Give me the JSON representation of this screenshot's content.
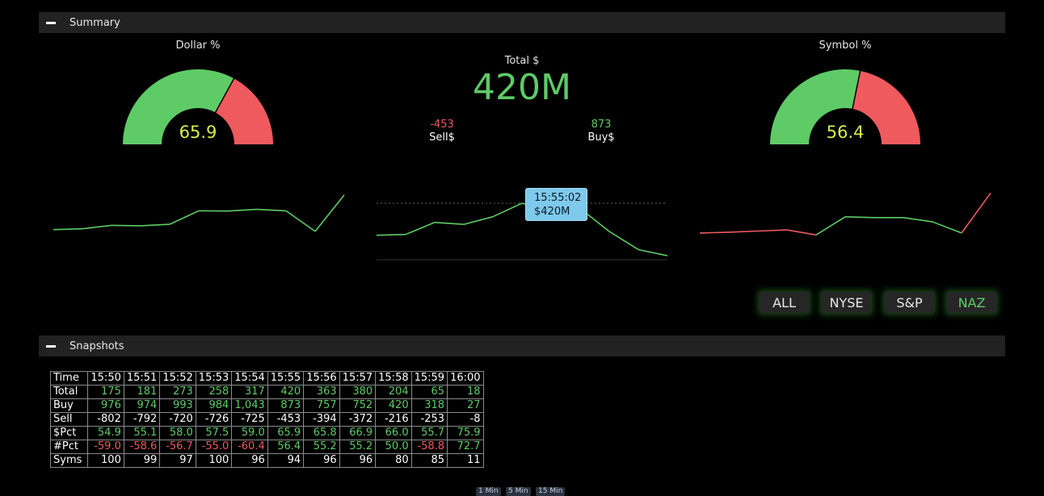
{
  "summary": {
    "title": "Summary"
  },
  "snapshots_section": {
    "title": "Snapshots"
  },
  "dollar_gauge": {
    "title": "Dollar %",
    "value": "65.9",
    "fraction": 0.659
  },
  "symbol_gauge": {
    "title": "Symbol %",
    "value": "56.4",
    "fraction": 0.564
  },
  "total": {
    "label": "Total $",
    "value": "420M"
  },
  "sell": {
    "value": "-453",
    "label": "Sell$"
  },
  "buy": {
    "value": "873",
    "label": "Buy$"
  },
  "tooltip": {
    "time": "15:55:02",
    "value": "$420M"
  },
  "colors": {
    "green": "#5ecb67",
    "red": "#ef5a5f",
    "gauge_text": "#d8f04a",
    "tooltip_bg": "#7ec9ec"
  },
  "charts": {
    "left_values": [
      420,
      440,
      520,
      510,
      545,
      860,
      855,
      895,
      860,
      380,
      1230
    ],
    "left_colors": [
      "green",
      "green",
      "green",
      "green",
      "green",
      "green",
      "green",
      "green",
      "green",
      "green"
    ],
    "middle_values": [
      175,
      181,
      273,
      258,
      317,
      420,
      363,
      380,
      204,
      65,
      18
    ],
    "middle_ref": 420,
    "right_values": [
      55.7,
      55.9,
      56.2,
      56.5,
      55.2,
      59.9,
      59.7,
      59.7,
      58.6,
      55.7,
      66.1
    ],
    "right_colors": [
      "red",
      "red",
      "red",
      "red",
      "green",
      "green",
      "green",
      "green",
      "green",
      "red"
    ]
  },
  "exchange_buttons": [
    {
      "label": "ALL",
      "active": false
    },
    {
      "label": "NYSE",
      "active": false
    },
    {
      "label": "S&P",
      "active": false
    },
    {
      "label": "NAZ",
      "active": true
    }
  ],
  "table": {
    "header": [
      "Time",
      "15:50",
      "15:51",
      "15:52",
      "15:53",
      "15:54",
      "15:55",
      "15:56",
      "15:57",
      "15:58",
      "15:59",
      "16:00"
    ],
    "rows": [
      {
        "label": "Total",
        "cells": [
          "175",
          "181",
          "273",
          "258",
          "317",
          "420",
          "363",
          "380",
          "204",
          "65",
          "18"
        ],
        "colors": [
          "g",
          "g",
          "g",
          "g",
          "g",
          "g",
          "g",
          "g",
          "g",
          "g",
          "g"
        ]
      },
      {
        "label": "Buy",
        "cells": [
          "976",
          "974",
          "993",
          "984",
          "1,043",
          "873",
          "757",
          "752",
          "420",
          "318",
          "27"
        ],
        "colors": [
          "g",
          "g",
          "g",
          "g",
          "g",
          "g",
          "g",
          "g",
          "g",
          "g",
          "g"
        ]
      },
      {
        "label": "Sell",
        "cells": [
          "-802",
          "-792",
          "-720",
          "-726",
          "-725",
          "-453",
          "-394",
          "-372",
          "-216",
          "-253",
          "-8"
        ],
        "colors": [
          "w",
          "w",
          "w",
          "w",
          "w",
          "w",
          "w",
          "w",
          "w",
          "w",
          "w"
        ]
      },
      {
        "label": "$Pct",
        "cells": [
          "54.9",
          "55.1",
          "58.0",
          "57.5",
          "59.0",
          "65.9",
          "65.8",
          "66.9",
          "66.0",
          "55.7",
          "75.9"
        ],
        "colors": [
          "g",
          "g",
          "g",
          "g",
          "g",
          "g",
          "g",
          "g",
          "g",
          "g",
          "g"
        ]
      },
      {
        "label": "#Pct",
        "cells": [
          "-59.0",
          "-58.6",
          "-56.7",
          "-55.0",
          "-60.4",
          "56.4",
          "55.2",
          "55.2",
          "50.0",
          "-58.8",
          "72.7"
        ],
        "colors": [
          "r",
          "r",
          "r",
          "r",
          "r",
          "g",
          "g",
          "g",
          "g",
          "r",
          "g"
        ]
      },
      {
        "label": "Syms",
        "cells": [
          "100",
          "99",
          "97",
          "100",
          "96",
          "94",
          "96",
          "96",
          "80",
          "85",
          "11"
        ],
        "colors": [
          "w",
          "w",
          "w",
          "w",
          "w",
          "w",
          "w",
          "w",
          "w",
          "w",
          "w"
        ]
      }
    ]
  },
  "interval_buttons": [
    "1 Min",
    "5 Min",
    "15 Min"
  ]
}
